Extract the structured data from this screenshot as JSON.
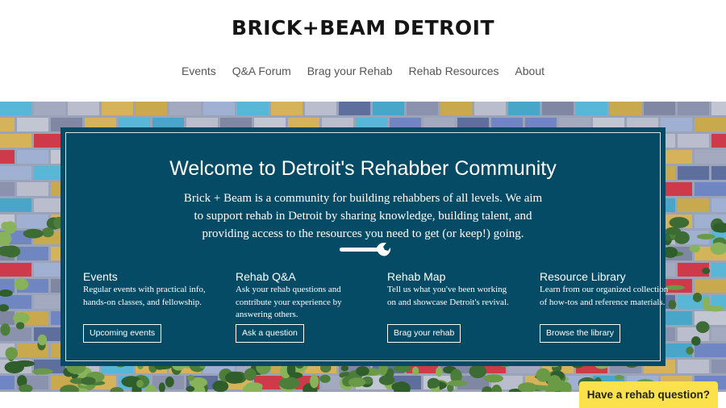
{
  "site": {
    "logo_text": "BRICK+BEAM DETROIT"
  },
  "nav": {
    "items": [
      {
        "label": "Events"
      },
      {
        "label": "Q&A Forum"
      },
      {
        "label": "Brag your Rehab"
      },
      {
        "label": "Rehab Resources"
      },
      {
        "label": "About"
      }
    ]
  },
  "hero": {
    "title": "Welcome to Detroit's Rehabber Community",
    "intro": "Brick + Beam is a community for building rehabbers of all levels. We aim to support rehab in Detroit by sharing knowledge, building talent, and providing access to the resources you need to get (or keep!) going.",
    "divider_icon": "wrench-icon",
    "panel_color": "#054b66",
    "columns": [
      {
        "title": "Events",
        "text": "Regular events with practical info, hands-on classes, and fellowship.",
        "button": "Upcoming events"
      },
      {
        "title": "Rehab Q&A",
        "text": "Ask your rehab questions and contribute your experience by answering others.",
        "button": "Ask a question"
      },
      {
        "title": "Rehab Map",
        "text": "Tell us what you've been working on and showcase Detroit's revival.",
        "button": "Brag your rehab"
      },
      {
        "title": "Resource Library",
        "text": "Learn from our organized collection of how-tos and reference materials.",
        "button": "Browse the library"
      }
    ]
  },
  "chat": {
    "label": "Have a rehab question?",
    "color": "#fbe14b"
  }
}
